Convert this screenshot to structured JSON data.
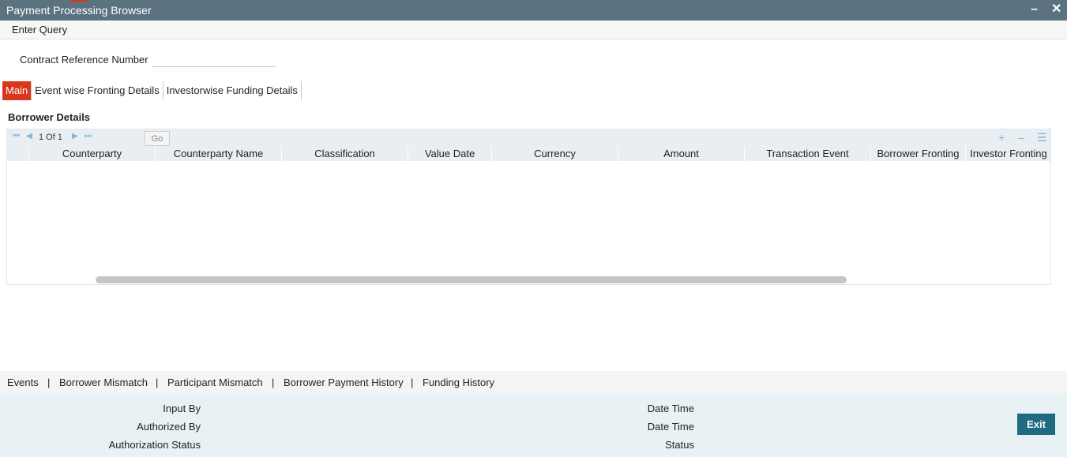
{
  "window": {
    "title": "Payment Processing Browser",
    "minimize_glyph": "–",
    "close_glyph": "✕"
  },
  "menu": {
    "enter_query": "Enter Query"
  },
  "query": {
    "contract_ref_label": "Contract Reference Number",
    "contract_ref_value": ""
  },
  "tabs": [
    {
      "label": "Main",
      "active": true
    },
    {
      "label": "Event wise Fronting Details",
      "active": false
    },
    {
      "label": "Investorwise Funding Details",
      "active": false
    }
  ],
  "borrower": {
    "title": "Borrower Details",
    "pagination": {
      "text": "1 Of 1",
      "go_label": "Go"
    },
    "icons": [
      "first-page-icon",
      "prev-page-icon",
      "next-page-icon",
      "last-page-icon",
      "add-row-icon",
      "delete-row-icon",
      "list-view-icon"
    ],
    "glyphs": {
      "first": "⏮",
      "prev": "◀",
      "next": "▶",
      "last": "⏭",
      "add": "+",
      "remove": "–",
      "list": "☰"
    },
    "columns": [
      "Counterparty",
      "Counterparty Name",
      "Classification",
      "Value Date",
      "Currency",
      "Amount",
      "Transaction Event",
      "Borrower Fronting",
      "Investor Fronting"
    ],
    "rows": []
  },
  "links": [
    "Events",
    "Borrower Mismatch",
    "Participant Mismatch",
    "Borrower Payment History",
    "Funding History"
  ],
  "link_separator": "|",
  "footer": {
    "input_by": "Input By",
    "authorized_by": "Authorized By",
    "authorization_status": "Authorization Status",
    "date_time_1": "Date Time",
    "date_time_2": "Date Time",
    "status": "Status",
    "exit": "Exit"
  },
  "colors": {
    "titlebar": "#5b7281",
    "accent": "#d9361c",
    "grid_header": "#e8eef1",
    "footer": "#e8f1f4",
    "exit_button": "#1f6b80"
  }
}
